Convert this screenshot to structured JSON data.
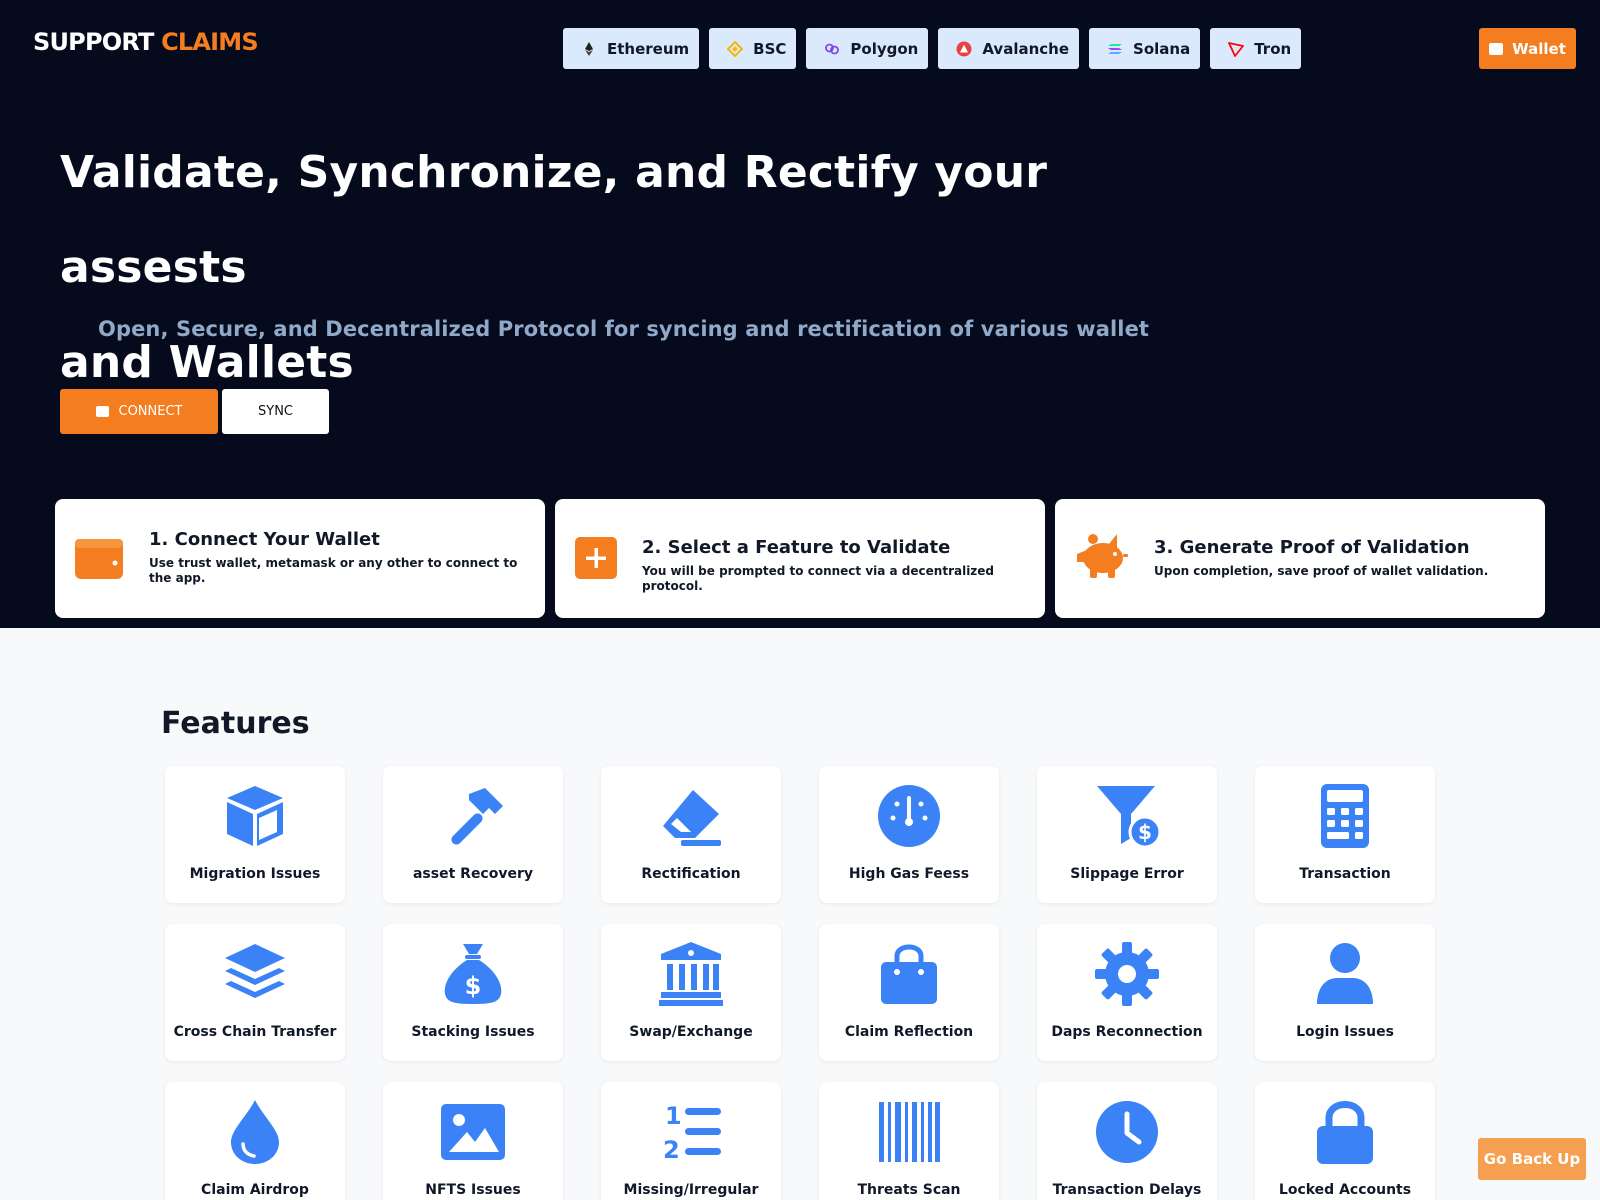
{
  "brand": {
    "part1": "SUPPORT",
    "part2": "CLAIMS"
  },
  "chains": [
    {
      "label": "Ethereum",
      "icon": "ethereum-icon"
    },
    {
      "label": "BSC",
      "icon": "bsc-icon"
    },
    {
      "label": "Polygon",
      "icon": "polygon-icon"
    },
    {
      "label": "Avalanche",
      "icon": "avalanche-icon"
    },
    {
      "label": "Solana",
      "icon": "solana-icon"
    },
    {
      "label": "Tron",
      "icon": "tron-icon"
    }
  ],
  "header": {
    "wallet_label": "Wallet"
  },
  "hero": {
    "headline_line1": "Validate, Synchronize, and Rectify your assests",
    "headline_line2": "and Wallets",
    "subline": "Open, Secure, and Decentralized Protocol for syncing and rectification of various wallet",
    "connect_label": "CONNECT",
    "sync_label": "SYNC"
  },
  "steps": [
    {
      "title": "1. Connect Your Wallet",
      "desc": "Use trust wallet, metamask or any other to connect to the app.",
      "icon": "wallet-icon"
    },
    {
      "title": "2. Select a Feature to Validate",
      "desc": "You will be prompted to connect via a decentralized protocol.",
      "icon": "plus-square-icon"
    },
    {
      "title": "3. Generate Proof of Validation",
      "desc": "Upon completion, save proof of wallet validation.",
      "icon": "piggy-bank-icon"
    }
  ],
  "features": {
    "title": "Features",
    "items": [
      {
        "label": "Migration Issues",
        "icon": "cube-icon"
      },
      {
        "label": "asset Recovery",
        "icon": "hammer-icon"
      },
      {
        "label": "Rectification",
        "icon": "eraser-icon"
      },
      {
        "label": "High Gas Feess",
        "icon": "gauge-icon"
      },
      {
        "label": "Slippage Error",
        "icon": "funnel-dollar-icon"
      },
      {
        "label": "Transaction",
        "icon": "calculator-icon"
      },
      {
        "label": "Cross Chain Transfer",
        "icon": "layers-icon"
      },
      {
        "label": "Stacking Issues",
        "icon": "money-bag-icon"
      },
      {
        "label": "Swap/Exchange",
        "icon": "bank-icon"
      },
      {
        "label": "Claim Reflection",
        "icon": "shopping-bag-icon"
      },
      {
        "label": "Daps Reconnection",
        "icon": "gear-icon"
      },
      {
        "label": "Login Issues",
        "icon": "user-icon"
      },
      {
        "label": "Claim Airdrop",
        "icon": "droplet-icon"
      },
      {
        "label": "NFTS Issues",
        "icon": "image-icon"
      },
      {
        "label": "Missing/Irregular",
        "icon": "list-ol-icon"
      },
      {
        "label": "Threats Scan",
        "icon": "barcode-icon"
      },
      {
        "label": "Transaction Delays",
        "icon": "clock-icon"
      },
      {
        "label": "Locked Accounts",
        "icon": "lock-icon"
      }
    ]
  },
  "footer": {
    "go_back_label": "Go Back Up"
  },
  "colors": {
    "hero_bg": "#050a1d",
    "accent": "#f47d20",
    "icon_blue": "#3b82f6",
    "chip_bg": "#dbe9fc"
  }
}
